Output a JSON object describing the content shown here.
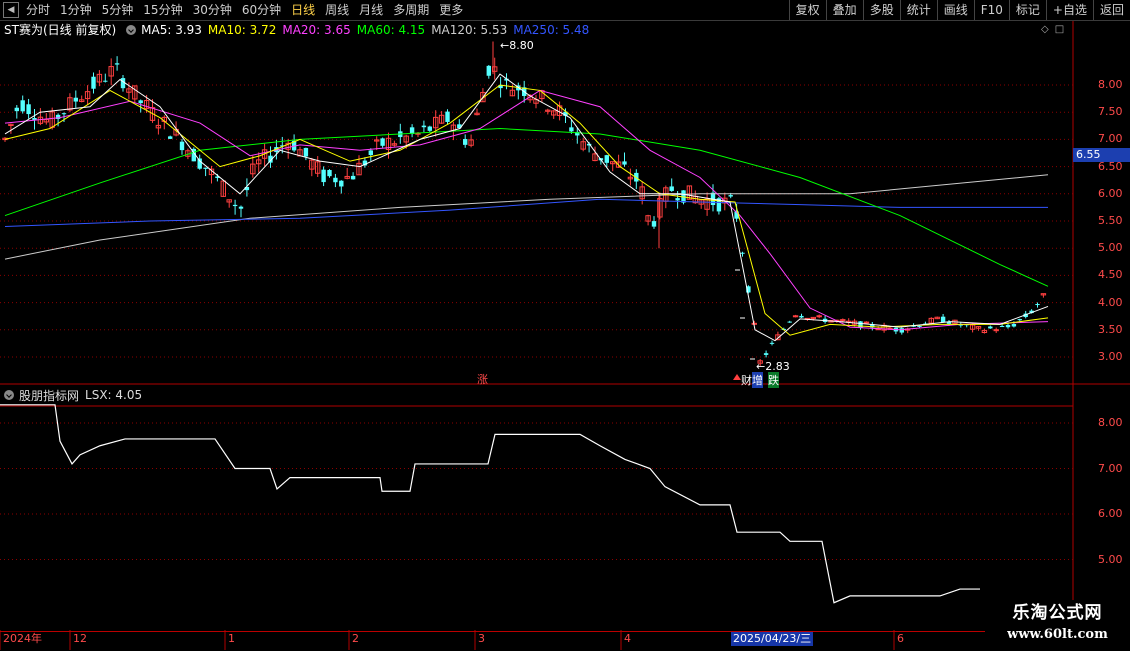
{
  "toolbar": {
    "periods": [
      "分时",
      "1分钟",
      "5分钟",
      "15分钟",
      "30分钟",
      "60分钟",
      "日线",
      "周线",
      "月线",
      "多周期",
      "更多"
    ],
    "active_period": "日线",
    "right_buttons": [
      "复权",
      "叠加",
      "多股",
      "统计",
      "画线",
      "F10",
      "标记",
      "+自选",
      "返回"
    ]
  },
  "main_legend": {
    "title": "ST赛为(日线 前复权)",
    "items": [
      {
        "label": "MA5: 3.93",
        "color": "#ffffff"
      },
      {
        "label": "MA10: 3.72",
        "color": "#ffff00"
      },
      {
        "label": "MA20: 3.65",
        "color": "#ff40ff"
      },
      {
        "label": "MA60: 4.15",
        "color": "#00ff00"
      },
      {
        "label": "MA120: 5.53",
        "color": "#cccccc"
      },
      {
        "label": "MA250: 5.48",
        "color": "#3355ff"
      }
    ]
  },
  "price_axis": [
    "8.00",
    "7.50",
    "7.00",
    "6.50",
    "6.00",
    "5.50",
    "5.00",
    "4.50",
    "4.00",
    "3.50",
    "3.00"
  ],
  "price_tag": "6.55",
  "annotations": {
    "high": "8.80",
    "low": "2.83",
    "zhang": "涨",
    "cai": "财",
    "zeng": "增",
    "die": "跌"
  },
  "sub_legend": {
    "title": "股朋指标网",
    "value": "LSX: 4.05"
  },
  "sub_axis": [
    "8.00",
    "7.00",
    "6.00",
    "5.00"
  ],
  "date_axis": {
    "labels": [
      {
        "text": "2024年"
      },
      {
        "text": "12"
      },
      {
        "text": "1"
      },
      {
        "text": "2"
      },
      {
        "text": "3"
      },
      {
        "text": "4"
      },
      {
        "text": "6"
      }
    ],
    "current": "2025/04/23/三"
  },
  "watermark": {
    "title": "乐淘公式网",
    "url": "www.60lt.com"
  },
  "colors": {
    "up": "#ff4040",
    "down": "#54ffff",
    "grid": "#8b0000"
  }
}
